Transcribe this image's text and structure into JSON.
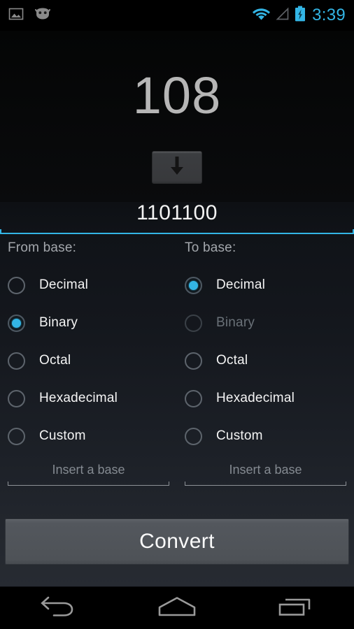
{
  "status_bar": {
    "icons": [
      "screenshot-image-icon",
      "android-mascot-icon",
      "wifi-icon",
      "cell-signal-icon",
      "battery-charging-icon"
    ],
    "time": "3:39",
    "accent_color": "#33b5e5"
  },
  "converter": {
    "input_value": "108",
    "swap_icon": "down-arrow-icon",
    "result_value": "1101100",
    "result_underline_color": "#33b5e5"
  },
  "from_base": {
    "title": "From base:",
    "selected": "Binary",
    "options": [
      {
        "label": "Decimal",
        "checked": false,
        "enabled": true
      },
      {
        "label": "Binary",
        "checked": true,
        "enabled": true
      },
      {
        "label": "Octal",
        "checked": false,
        "enabled": true
      },
      {
        "label": "Hexadecimal",
        "checked": false,
        "enabled": true
      },
      {
        "label": "Custom",
        "checked": false,
        "enabled": true
      }
    ],
    "custom_input": {
      "value": "",
      "placeholder": "Insert a base"
    }
  },
  "to_base": {
    "title": "To base:",
    "selected": "Decimal",
    "options": [
      {
        "label": "Decimal",
        "checked": true,
        "enabled": true
      },
      {
        "label": "Binary",
        "checked": false,
        "enabled": false
      },
      {
        "label": "Octal",
        "checked": false,
        "enabled": true
      },
      {
        "label": "Hexadecimal",
        "checked": false,
        "enabled": true
      },
      {
        "label": "Custom",
        "checked": false,
        "enabled": true
      }
    ],
    "custom_input": {
      "value": "",
      "placeholder": "Insert a base"
    }
  },
  "convert_button": {
    "label": "Convert"
  },
  "nav_bar": {
    "buttons": [
      {
        "name": "back-button",
        "icon": "back-arrow-icon"
      },
      {
        "name": "home-button",
        "icon": "home-icon"
      },
      {
        "name": "recents-button",
        "icon": "recents-icon"
      }
    ]
  }
}
